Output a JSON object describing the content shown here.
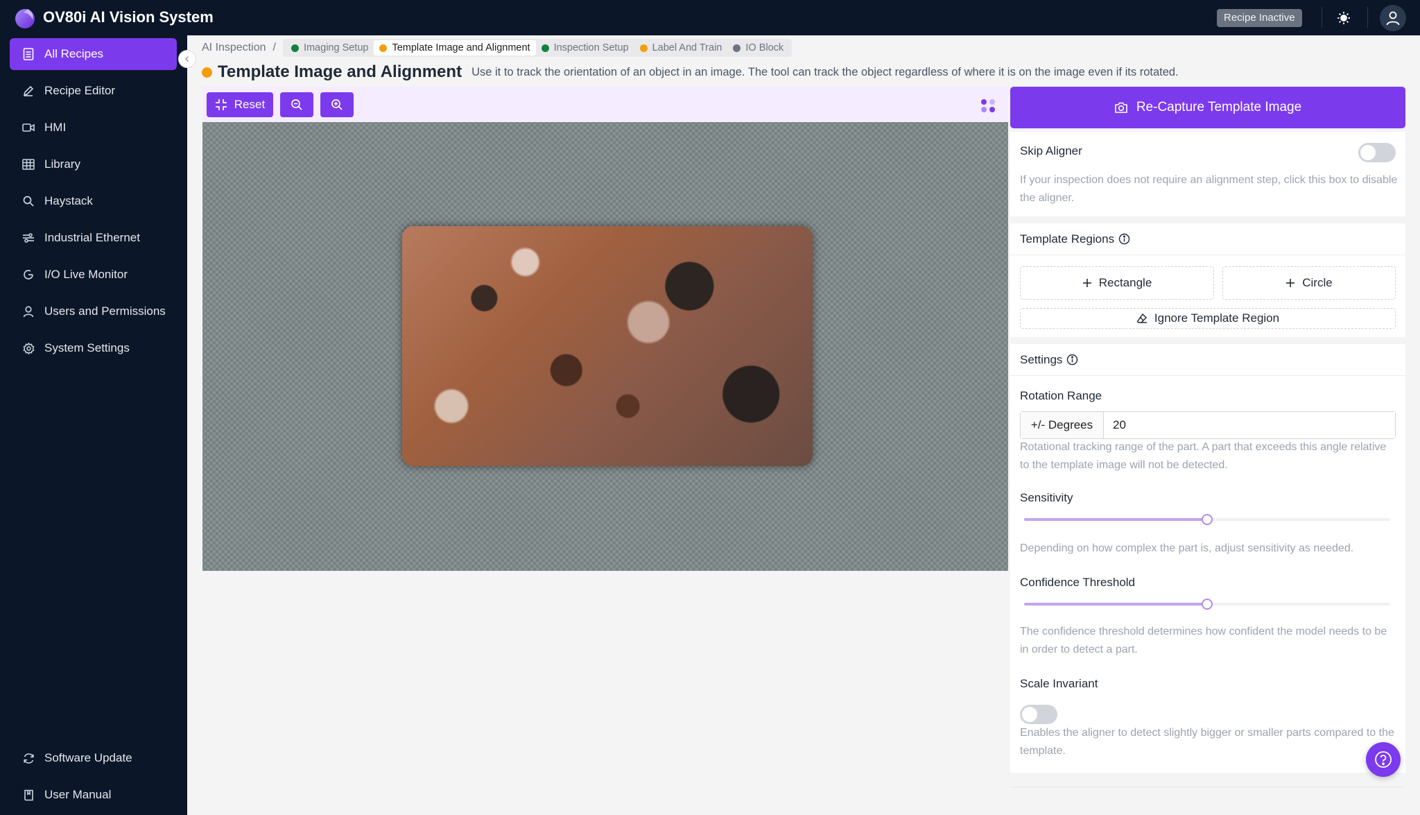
{
  "app": {
    "title": "OV80i AI Vision System",
    "status_badge": "Recipe Inactive"
  },
  "sidebar": {
    "items": [
      {
        "label": "All Recipes",
        "icon": "document-icon"
      },
      {
        "label": "Recipe Editor",
        "icon": "pencil-icon"
      },
      {
        "label": "HMI",
        "icon": "video-icon"
      },
      {
        "label": "Library",
        "icon": "table-icon"
      },
      {
        "label": "Haystack",
        "icon": "search-icon"
      },
      {
        "label": "Industrial Ethernet",
        "icon": "network-icon"
      },
      {
        "label": "I/O Live Monitor",
        "icon": "gauge-icon"
      },
      {
        "label": "Users and Permissions",
        "icon": "user-icon"
      },
      {
        "label": "System Settings",
        "icon": "gear-icon"
      }
    ],
    "bottom_items": [
      {
        "label": "Software Update",
        "icon": "refresh-icon"
      },
      {
        "label": "User Manual",
        "icon": "book-icon"
      }
    ],
    "active_index": 0
  },
  "breadcrumb": {
    "root": "AI Inspection",
    "separator": "/",
    "steps": [
      {
        "label": "Imaging Setup",
        "status": "green"
      },
      {
        "label": "Template Image and Alignment",
        "status": "orange"
      },
      {
        "label": "Inspection Setup",
        "status": "green"
      },
      {
        "label": "Label And Train",
        "status": "orange"
      },
      {
        "label": "IO Block",
        "status": "gray"
      }
    ]
  },
  "page": {
    "title": "Template Image and Alignment",
    "description": "Use it to track the orientation of an object in an image. The tool can track the object regardless of where it is on the image even if its rotated."
  },
  "toolbar": {
    "reset_label": "Reset"
  },
  "panel": {
    "recapture_label": "Re-Capture Template Image",
    "skip_aligner": {
      "label": "Skip Aligner",
      "enabled": false,
      "help": "If your inspection does not require an alignment step, click this box to disable the aligner."
    },
    "template_regions": {
      "title": "Template Regions",
      "rectangle_label": "Rectangle",
      "circle_label": "Circle",
      "ignore_label": "Ignore Template Region"
    },
    "settings": {
      "title": "Settings",
      "rotation_range": {
        "label": "Rotation Range",
        "addon": "+/- Degrees",
        "value": "20",
        "help": "Rotational tracking range of the part. A part that exceeds this angle relative to the template image will not be detected."
      },
      "sensitivity": {
        "label": "Sensitivity",
        "value": 0.5,
        "help": "Depending on how complex the part is, adjust sensitivity as needed."
      },
      "confidence": {
        "label": "Confidence Threshold",
        "value": 0.5,
        "help": "The confidence threshold determines how confident the model needs to be in order to detect a part."
      },
      "scale_invariant": {
        "label": "Scale Invariant",
        "enabled": false,
        "help": "Enables the aligner to detect slightly bigger or smaller parts compared to the template."
      }
    }
  },
  "colors": {
    "accent": "#7c3aed",
    "topbar": "#0b1729",
    "status_green": "#15803d",
    "status_orange": "#f59e0b",
    "status_gray": "#6b7280"
  }
}
